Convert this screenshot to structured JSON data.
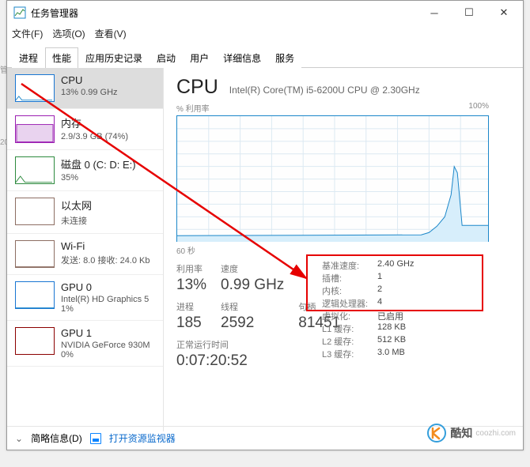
{
  "window": {
    "title": "任务管理器"
  },
  "menu": {
    "file": "文件(F)",
    "options": "选项(O)",
    "view": "查看(V)"
  },
  "tabs": [
    "进程",
    "性能",
    "应用历史记录",
    "启动",
    "用户",
    "详细信息",
    "服务"
  ],
  "sidebar": [
    {
      "title": "CPU",
      "sub": "13% 0.99 GHz",
      "color": "#1c87c9"
    },
    {
      "title": "内存",
      "sub": "2.9/3.9 GB (74%)",
      "color": "#9b1fb2"
    },
    {
      "title": "磁盘 0 (C: D: E:)",
      "sub": "35%",
      "color": "#2d8a3e"
    },
    {
      "title": "以太网",
      "sub": "未连接",
      "color": "#8d6e63"
    },
    {
      "title": "Wi-Fi",
      "sub": "发送: 8.0 接收: 24.0 Kb",
      "color": "#8d6e63"
    },
    {
      "title": "GPU 0",
      "sub": "Intel(R) HD Graphics 5\n1%",
      "color": "#1c87c9"
    },
    {
      "title": "GPU 1",
      "sub": "NVIDIA GeForce 930M\n0%",
      "color": "#8b0000"
    }
  ],
  "main": {
    "title": "CPU",
    "model": "Intel(R) Core(TM) i5-6200U CPU @ 2.30GHz",
    "util_label": "% 利用率",
    "util_max": "100%",
    "x_axis": "60 秒",
    "stats": {
      "util": {
        "label": "利用率",
        "value": "13%"
      },
      "speed": {
        "label": "速度",
        "value": "0.99 GHz"
      },
      "proc": {
        "label": "进程",
        "value": "185"
      },
      "threads": {
        "label": "线程",
        "value": "2592"
      },
      "handles": {
        "label": "句柄",
        "value": "81451"
      }
    },
    "uptime": {
      "label": "正常运行时间",
      "value": "0:07:20:52"
    },
    "kv": [
      {
        "k": "基准速度:",
        "v": "2.40 GHz"
      },
      {
        "k": "插槽:",
        "v": "1"
      },
      {
        "k": "内核:",
        "v": "2"
      },
      {
        "k": "逻辑处理器:",
        "v": "4"
      },
      {
        "k": "虚拟化:",
        "v": "已启用"
      },
      {
        "k": "L1 缓存:",
        "v": "128 KB"
      },
      {
        "k": "L2 缓存:",
        "v": "512 KB"
      },
      {
        "k": "L3 缓存:",
        "v": "3.0 MB"
      }
    ]
  },
  "footer": {
    "less": "简略信息(D)",
    "resmon": "打开资源监视器"
  },
  "watermark": {
    "text": "酷知",
    "url": "coozhi.com"
  },
  "chart_data": {
    "type": "line",
    "title": "% 利用率",
    "xlabel": "60 秒",
    "ylabel": "%",
    "ylim": [
      0,
      100
    ],
    "x_range_seconds": 60,
    "series": [
      {
        "name": "CPU 利用率",
        "values": [
          5,
          5,
          5,
          5,
          5,
          5,
          6,
          6,
          5,
          5,
          6,
          6,
          5,
          5,
          6,
          6,
          5,
          6,
          6,
          5,
          6,
          7,
          6,
          5,
          6,
          7,
          5,
          6,
          5,
          6,
          6,
          5,
          6,
          6,
          5,
          5,
          6,
          5,
          5,
          5,
          5,
          6,
          5,
          5,
          5,
          5,
          6,
          6,
          8,
          12,
          20,
          35,
          60,
          55,
          13,
          13,
          13,
          13,
          13,
          13
        ]
      }
    ]
  }
}
